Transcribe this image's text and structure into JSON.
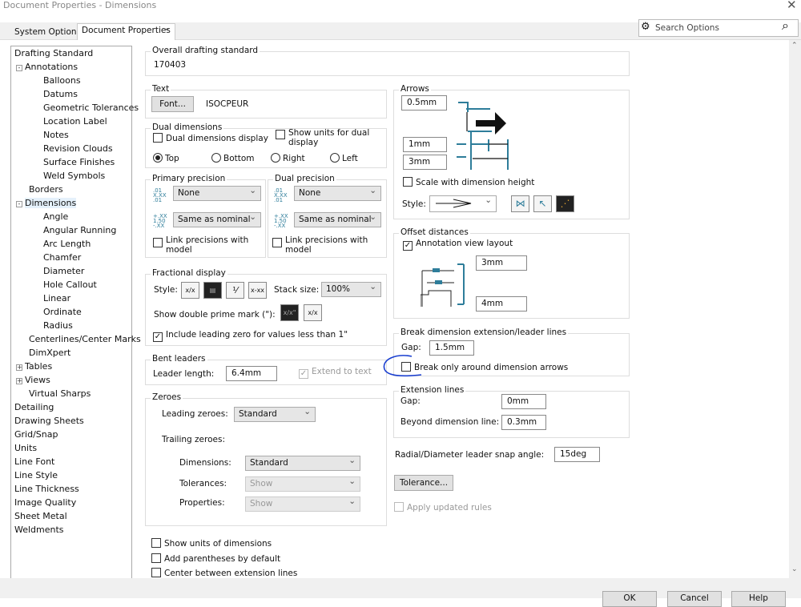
{
  "window": {
    "title": "Document Properties - Dimensions"
  },
  "tabs": [
    {
      "label": "System Options"
    },
    {
      "label": "Document Properties"
    }
  ],
  "search": {
    "placeholder": "Search Options"
  },
  "tree": [
    {
      "label": "Drafting Standard",
      "level": 0
    },
    {
      "label": "Annotations",
      "level": 1,
      "expander": "-"
    },
    {
      "label": "Balloons",
      "level": 2
    },
    {
      "label": "Datums",
      "level": 2
    },
    {
      "label": "Geometric Tolerances",
      "level": 2
    },
    {
      "label": "Location Label",
      "level": 2
    },
    {
      "label": "Notes",
      "level": 2
    },
    {
      "label": "Revision Clouds",
      "level": 2
    },
    {
      "label": "Surface Finishes",
      "level": 2
    },
    {
      "label": "Weld Symbols",
      "level": 2
    },
    {
      "label": "Borders",
      "level": 1
    },
    {
      "label": "Dimensions",
      "level": 1,
      "expander": "-",
      "selected": true
    },
    {
      "label": "Angle",
      "level": 2
    },
    {
      "label": "Angular Running",
      "level": 2
    },
    {
      "label": "Arc Length",
      "level": 2
    },
    {
      "label": "Chamfer",
      "level": 2
    },
    {
      "label": "Diameter",
      "level": 2
    },
    {
      "label": "Hole Callout",
      "level": 2
    },
    {
      "label": "Linear",
      "level": 2
    },
    {
      "label": "Ordinate",
      "level": 2
    },
    {
      "label": "Radius",
      "level": 2
    },
    {
      "label": "Centerlines/Center Marks",
      "level": 1
    },
    {
      "label": "DimXpert",
      "level": 1
    },
    {
      "label": "Tables",
      "level": 1,
      "expander": "+"
    },
    {
      "label": "Views",
      "level": 1,
      "expander": "+"
    },
    {
      "label": "Virtual Sharps",
      "level": 1
    },
    {
      "label": "Detailing",
      "level": 0
    },
    {
      "label": "Drawing Sheets",
      "level": 0
    },
    {
      "label": "Grid/Snap",
      "level": 0
    },
    {
      "label": "Units",
      "level": 0
    },
    {
      "label": "Line Font",
      "level": 0
    },
    {
      "label": "Line Style",
      "level": 0
    },
    {
      "label": "Line Thickness",
      "level": 0
    },
    {
      "label": "Image Quality",
      "level": 0
    },
    {
      "label": "Sheet Metal",
      "level": 0
    },
    {
      "label": "Weldments",
      "level": 0
    }
  ],
  "overall": {
    "legend": "Overall drafting standard",
    "value": "170403"
  },
  "text": {
    "legend": "Text",
    "font_button": "Font...",
    "font_name": "ISOCPEUR"
  },
  "dual": {
    "legend": "Dual dimensions",
    "display": "Dual dimensions display",
    "show_units": "Show units for dual display",
    "radios": [
      "Top",
      "Bottom",
      "Right",
      "Left"
    ],
    "selected": "Top"
  },
  "primary": {
    "legend": "Primary precision",
    "value": "None",
    "tolerance": "Same as nominal",
    "link": "Link precisions with model"
  },
  "dualprec": {
    "legend": "Dual precision",
    "value": "None",
    "tolerance": "Same as nominal",
    "link": "Link precisions with model"
  },
  "fraction": {
    "legend": "Fractional display",
    "style_label": "Style:",
    "stack_label": "Stack size:",
    "stack_value": "100%",
    "prime_label": "Show double prime mark (\"):",
    "leading_zero": "Include leading zero for values less than 1\""
  },
  "bent": {
    "legend": "Bent leaders",
    "length_label": "Leader length:",
    "length_value": "6.4mm",
    "extend": "Extend to text"
  },
  "zeroes": {
    "legend": "Zeroes",
    "leading_label": "Leading zeroes:",
    "leading_value": "Standard",
    "trailing_label": "Trailing zeroes:",
    "dim_label": "Dimensions:",
    "dim_value": "Standard",
    "tol_label": "Tolerances:",
    "tol_value": "Show",
    "prop_label": "Properties:",
    "prop_value": "Show"
  },
  "bottom": {
    "show_units": "Show units of dimensions",
    "parentheses": "Add parentheses by default",
    "center": "Center between extension lines"
  },
  "arrows": {
    "legend": "Arrows",
    "v1": "0.5mm",
    "v2": "1mm",
    "v3": "3mm",
    "scale": "Scale with dimension height",
    "style_label": "Style:"
  },
  "offset": {
    "legend": "Offset distances",
    "layout": "Annotation view layout",
    "v1": "3mm",
    "v2": "4mm"
  },
  "break": {
    "legend": "Break dimension extension/leader lines",
    "gap_label": "Gap:",
    "gap_value": "1.5mm",
    "only_arrows": "Break only around dimension arrows"
  },
  "ext": {
    "legend": "Extension lines",
    "gap_label": "Gap:",
    "gap_value": "0mm",
    "beyond_label": "Beyond dimension line:",
    "beyond_value": "0.3mm"
  },
  "radial": {
    "label": "Radial/Diameter leader snap angle:",
    "value": "15deg"
  },
  "tolerance_button": "Tolerance...",
  "apply_rules": "Apply updated rules",
  "footer": {
    "ok": "OK",
    "cancel": "Cancel",
    "help": "Help"
  },
  "colors": {
    "diagram_blue": "#2e7d9a",
    "annotation_ink": "#1a3fd0"
  }
}
